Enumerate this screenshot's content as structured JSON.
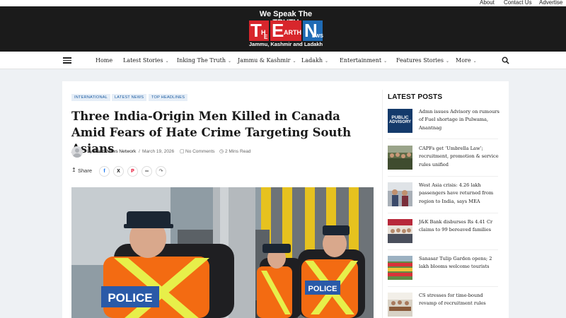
{
  "topbar": {
    "links": [
      "About",
      "Contact Us",
      "Advertise W"
    ]
  },
  "logo": {
    "tagline": "We Speak The TRUTH",
    "letters": [
      "T",
      "H",
      "E",
      "E",
      "ARTH",
      "N",
      "EWS"
    ],
    "subtitle": "Jammu, Kashmir and Ladakh"
  },
  "nav": {
    "items": [
      {
        "label": "Home",
        "chevron": ""
      },
      {
        "label": "Latest Stories",
        "chevron": "⌄"
      },
      {
        "label": "Inking The Truth",
        "chevron": "⌄"
      },
      {
        "label": "Jammu & Kashmir",
        "chevron": "⌄"
      },
      {
        "label": "Ladakh",
        "chevron": "⌄"
      },
      {
        "label": "Entertainment",
        "chevron": "⌄"
      },
      {
        "label": "Features Stories",
        "chevron": "⌄"
      },
      {
        "label": "More",
        "chevron": "⌄"
      }
    ]
  },
  "article": {
    "categories": [
      "INTERNATIONAL",
      "LATEST NEWS",
      "TOP HEADLINES"
    ],
    "title": "Three India-Origin Men Killed in Canada Amid Fears of Hate Crime Targeting South Asians",
    "by": "By",
    "author": "Earth News Network",
    "date": "March 19, 2026",
    "comments": "No Comments",
    "read_time": "2 Mins Read",
    "share_label": "Share",
    "hero_vest_text": "POLICE"
  },
  "sidebar": {
    "title": "LATEST POSTS",
    "thumb_text": [
      "PUBLIC",
      "ADVISORY"
    ],
    "posts": [
      {
        "title": "Admn issues Advisory on rumours of Fuel shortage in Pulwama, Anantnag"
      },
      {
        "title": "CAPFs get ‘Umbrella Law’; recruitment, promotion & service rules unified"
      },
      {
        "title": "West Asia crisis: 4.26 lakh passengers have returned from region to India, says MEA"
      },
      {
        "title": "J&K Bank disburses Rs 4.41 Cr claims to 99 bereaved families"
      },
      {
        "title": "Sanasar Tulip Garden opens; 2 lakh blooms welcome tourists"
      },
      {
        "title": "CS stresses for time-bound revamp of recruitment rules"
      }
    ]
  },
  "colors": {
    "accent": "#1a5aa0",
    "logo_red": "#d8262c",
    "logo_blue": "#1f6bb5",
    "masthead": "#1b1b1b"
  }
}
